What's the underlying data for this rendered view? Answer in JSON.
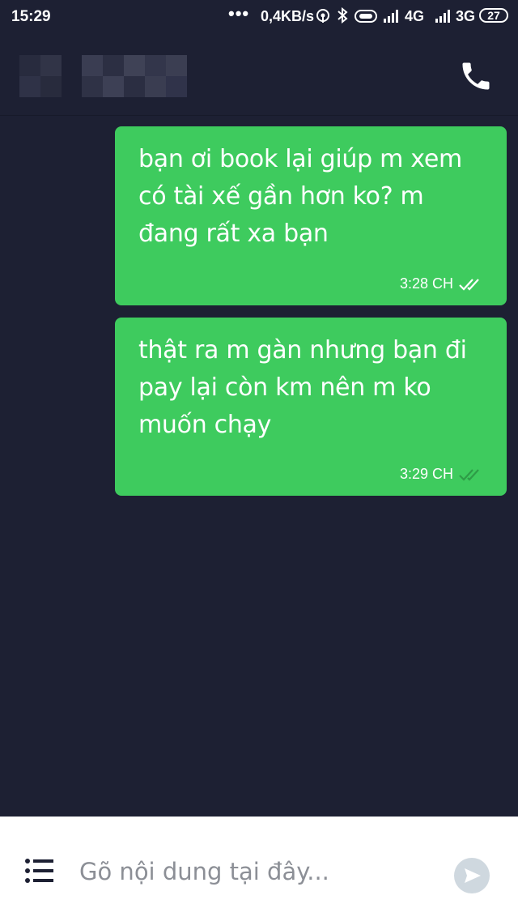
{
  "status_bar": {
    "time": "15:29",
    "dots": "•••",
    "net_speed": "0,4KB/s",
    "network_1": "4G",
    "network_2": "3G",
    "battery": "27"
  },
  "header": {
    "icons": [
      "blurred-avatar",
      "blurred-contact-name",
      "phone-icon"
    ]
  },
  "messages": [
    {
      "text": "bạn ơi book lại giúp m xem có tài xế gần hơn ko? m đang rất xa bạn",
      "time": "3:28 CH",
      "read_icon": "double-check-icon"
    },
    {
      "text": "thật ra m gàn nhưng bạn đi pay lại còn km nên m ko muốn chạy",
      "time": "3:29 CH",
      "read_icon": "double-check-icon"
    }
  ],
  "composer": {
    "placeholder": "Gõ nội dung tại đây...",
    "menu_icon": "list-menu-icon",
    "send_icon": "send-icon"
  },
  "colors": {
    "background": "#1d2033",
    "bubble": "#3ecb5e",
    "check_read": "#ffffff",
    "check_delivered": "#2e9c47",
    "composer_bg": "#ffffff",
    "send_button": "#cfd8df"
  }
}
